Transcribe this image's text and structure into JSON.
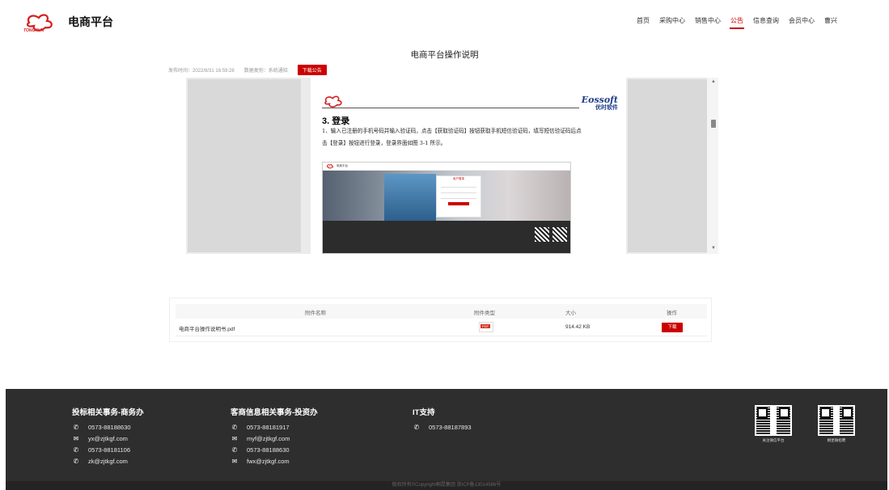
{
  "header": {
    "logo_text": "电商平台",
    "nav": [
      "首页",
      "采购中心",
      "销售中心",
      "公告",
      "信息查询",
      "会员中心",
      "曹兴"
    ],
    "active_nav": "公告"
  },
  "notice": {
    "title": "电商平台操作说明",
    "publish_time": "发布时间：2022/8/31 16:59:28",
    "category": "数据类别：系统通知",
    "download_label": "下载公告"
  },
  "document": {
    "brand": "Eossoft",
    "brand_cn": "优时软件",
    "heading": "3. 登录",
    "paragraph": "1、输入已注册的手机号码并输入验证码，点击【获取验证码】按钮获取手机短信验证码，填写短信验证码后点击【登录】按钮进行登录，登录界面如图 3-1 所示。",
    "shot_logo_text": "电商平台",
    "shot_login_title": "用户登录"
  },
  "attachments": {
    "headers": [
      "附件名称",
      "附件类型",
      "大小",
      "操作"
    ],
    "rows": [
      {
        "name": "电商平台操作说明书.pdf",
        "type_icon": "pdf-icon",
        "size": "914.42 KB",
        "action": "下载"
      }
    ]
  },
  "footer": {
    "columns": [
      {
        "title": "投标相关事务-商务办",
        "lines": [
          {
            "icon": "phone-icon",
            "text": "0573-88188630"
          },
          {
            "icon": "mail-icon",
            "text": "yx@zjtkgf.com"
          },
          {
            "icon": "phone-icon",
            "text": "0573-88181106"
          },
          {
            "icon": "phone-icon",
            "text": "zk@zjtkgf.com"
          }
        ]
      },
      {
        "title": "客商信息相关事务-投资办",
        "lines": [
          {
            "icon": "phone-icon",
            "text": "0573-88181917"
          },
          {
            "icon": "mail-icon",
            "text": "myf@zjtkgf.com"
          },
          {
            "icon": "phone-icon",
            "text": "0573-88188630"
          },
          {
            "icon": "mail-icon",
            "text": "fwx@zjtkgf.com"
          }
        ]
      },
      {
        "title": "IT支持",
        "lines": [
          {
            "icon": "phone-icon",
            "text": "0573-88187893"
          }
        ]
      }
    ],
    "qr": [
      {
        "caption": "关注微信平台"
      },
      {
        "caption": "桐昆微招聘"
      }
    ],
    "copyright": "版权所有©Copyright桐昆集团    浙ICP备13014586号"
  },
  "colors": {
    "accent": "#cc0000",
    "footer_bg": "#2e2e2e",
    "doc_brand": "#1f3f8a"
  }
}
